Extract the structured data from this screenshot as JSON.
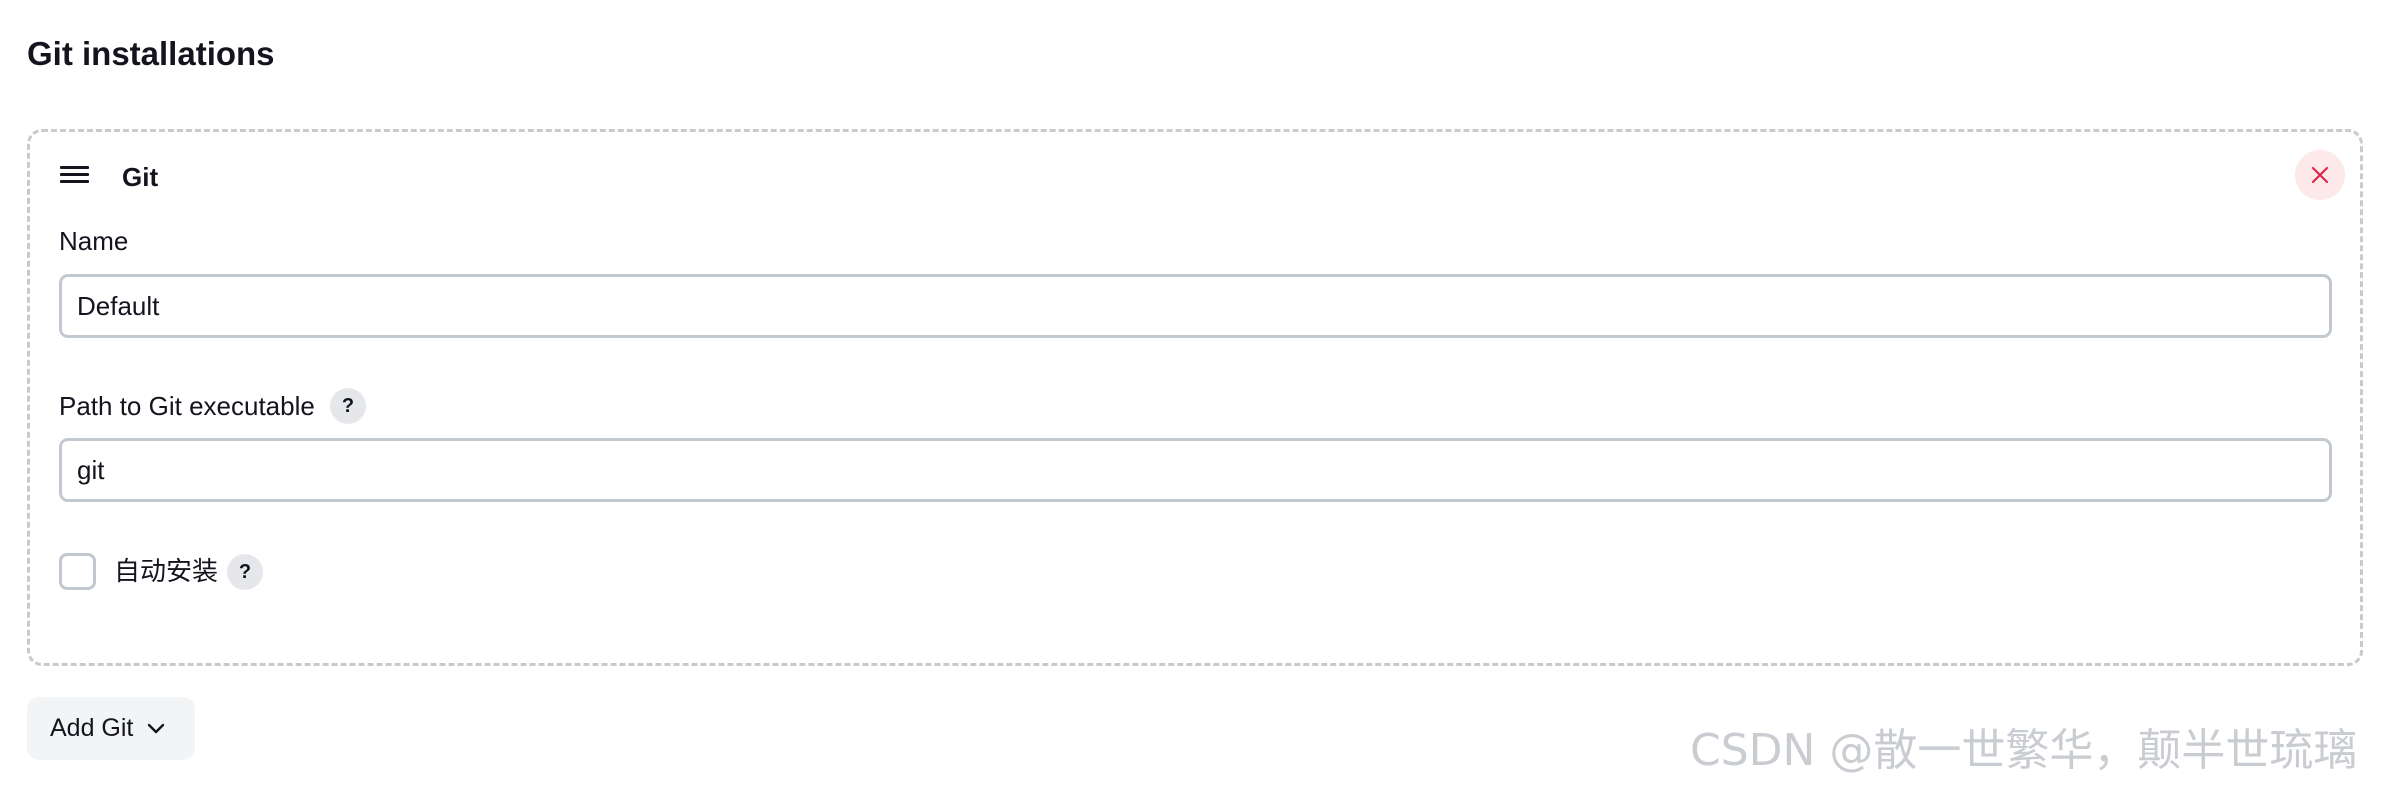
{
  "section": {
    "title": "Git installations"
  },
  "installation": {
    "title": "Git",
    "name_label": "Name",
    "name_value": "Default",
    "path_label": "Path to Git executable",
    "path_value": "git",
    "auto_install_label": "自动安装",
    "auto_install_checked": false,
    "help_glyph": "?"
  },
  "actions": {
    "add_label": "Add Git"
  },
  "icons": {
    "drag": "drag-handle-icon",
    "delete": "close-icon",
    "help": "help-icon",
    "dropdown": "chevron-down-icon"
  },
  "colors": {
    "delete_bg": "#fde8ea",
    "delete_fg": "#e0284f",
    "border": "#c2c8cf",
    "button_bg": "#f3f4f6"
  },
  "watermark": "CSDN @散一世繁华，颠半世琉璃"
}
